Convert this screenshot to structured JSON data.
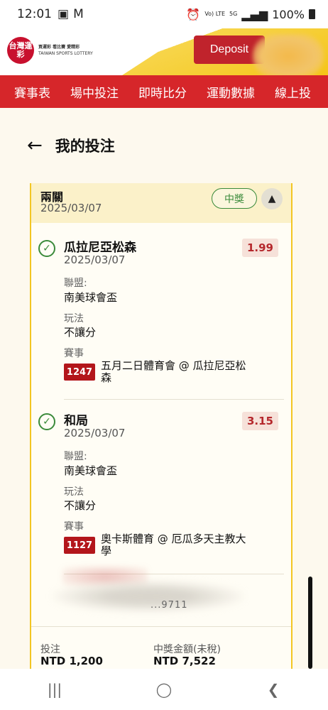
{
  "status_bar": {
    "time": "12:01",
    "battery": "100%",
    "network": "5G",
    "volte": "Vo) LTE"
  },
  "header": {
    "logo_text": "台灣運彩",
    "logo_sub_cn": "買運彩 看比賽 愛精彩",
    "logo_sub_en": "TAIWAN SPORTS LOTTERY",
    "deposit_label": "Deposit"
  },
  "nav": {
    "items": [
      "賽事表",
      "場中投注",
      "即時比分",
      "運動數據",
      "線上投"
    ]
  },
  "page": {
    "title": "我的投注"
  },
  "bet": {
    "type": "兩關",
    "date": "2025/03/07",
    "status": "中獎",
    "legs": [
      {
        "pick": "瓜拉尼亞松森",
        "date": "2025/03/07",
        "odds": "1.99",
        "league_label": "聯盟:",
        "league": "南美球會盃",
        "market_label": "玩法",
        "market": "不讓分",
        "event_label": "賽事",
        "match_code": "1247",
        "match_name": "五月二日體育會 @ 瓜拉尼亞松森"
      },
      {
        "pick": "和局",
        "date": "2025/03/07",
        "odds": "3.15",
        "league_label": "聯盟:",
        "league": "南美球會盃",
        "market_label": "玩法",
        "market": "不讓分",
        "event_label": "賽事",
        "match_code": "1127",
        "match_name": "奧卡斯體育 @ 厄瓜多天主教大學"
      }
    ],
    "redacted_id": "...9711",
    "stake_label": "投注",
    "stake_value": "NTD 1,200",
    "payout_label": "中獎金額(未稅)",
    "payout_value": "NTD 7,522"
  },
  "colors": {
    "brand_red": "#d6262a",
    "accent_yellow": "#f3c623",
    "win_green": "#3a8a3a"
  }
}
